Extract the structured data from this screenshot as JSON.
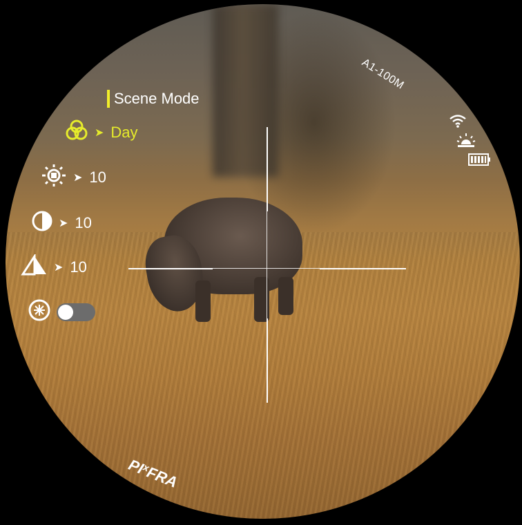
{
  "model": "A1-100M",
  "menu": {
    "title": "Scene Mode",
    "scene": {
      "icon": "cloud-scene-icon",
      "value": "Day"
    },
    "brightness": {
      "icon": "brightness-icon",
      "value": "10"
    },
    "contrast": {
      "icon": "contrast-icon",
      "value": "10"
    },
    "sharpness": {
      "icon": "sharpness-icon",
      "value": "10"
    },
    "enhance": {
      "icon": "enhance-icon",
      "toggle_on": false
    }
  },
  "status": {
    "wifi": "wifi-icon",
    "alarm": "alarm-icon",
    "battery": "battery-icon"
  },
  "brand": "PIXFRA",
  "colors": {
    "accent": "#f2ee2a",
    "text": "#ffffff",
    "toggle_off": "#6c6c6c"
  }
}
